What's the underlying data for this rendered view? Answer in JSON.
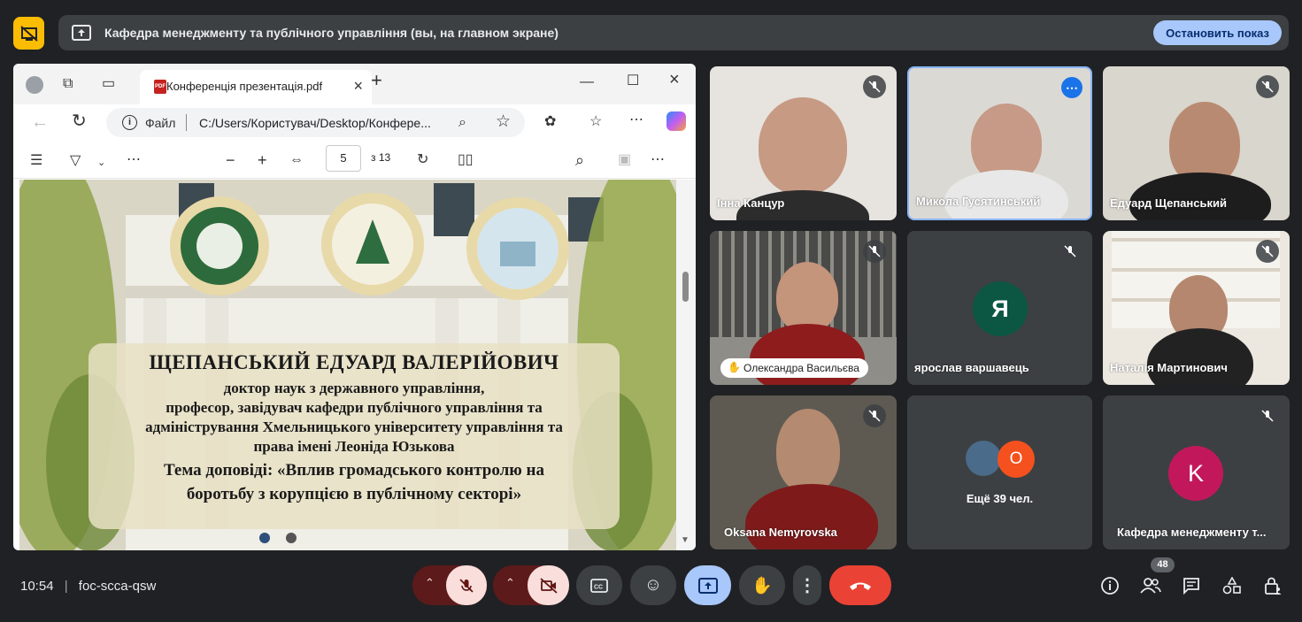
{
  "banner": {
    "text": "Кафедра менеджменту та публічного управління (вы, на главном экране)",
    "stop_label": "Остановить показ"
  },
  "browser": {
    "tab_title": "Конференція презентація.pdf",
    "url_prefix": "Файл",
    "url": "C:/Users/Користувач/Desktop/Конфере...",
    "page_current": "5",
    "page_total": "з 13"
  },
  "slide": {
    "name": "ЩЕПАНСЬКИЙ ЕДУАРД ВАЛЕРІЙОВИЧ",
    "line1": "доктор наук з державного управління,",
    "line2": "професор, завідувач кафедри публічного управління та",
    "line3": "адміністрування Хмельницького університету управління та",
    "line4": "права імені Леоніда Юзькова",
    "line5": "Тема доповіді: «Вплив громадського контролю на",
    "line6": "боротьбу з корупцією в публічному секторі»"
  },
  "participants": [
    {
      "name": "Інна Канцур",
      "muted": true
    },
    {
      "name": "Микола Гусятинський",
      "muted": false
    },
    {
      "name": "Едуард Щепанський",
      "muted": true
    },
    {
      "name": "Олександра Васильєва",
      "muted": true,
      "hand_raised": true
    },
    {
      "name": "ярослав варшавець",
      "muted": true,
      "initial": "Я",
      "avatar_color": "#0b5743"
    },
    {
      "name": "Наталія Мартинович",
      "muted": true
    },
    {
      "name": "Oksana Nemyrovska",
      "muted": true
    },
    {
      "name": "Ещё 39 чел.",
      "initial": "O",
      "avatar_color": "#f4511e"
    },
    {
      "name": "Кафедра менеджменту т...",
      "muted": true,
      "initial": "K",
      "avatar_color": "#c2185b"
    }
  ],
  "meeting": {
    "time": "10:54",
    "code": "foc-scca-qsw",
    "people_count": "48"
  },
  "colors": {
    "accent": "#a8c7fa",
    "end_call": "#ea4335",
    "muted_bg": "#f9dedc",
    "stop_share_square": "#fbbc04"
  }
}
